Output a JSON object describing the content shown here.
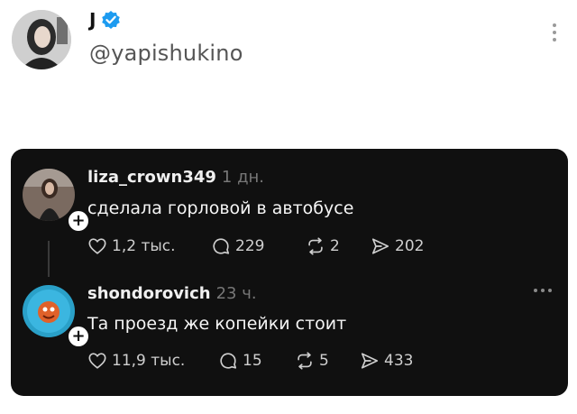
{
  "header": {
    "display_name": "J",
    "handle": "@yapishukino",
    "verified_icon": "verified-badge-icon",
    "menu_icon": "more-vertical-icon"
  },
  "colors": {
    "verified_blue": "#1d9bf0",
    "card_bg": "#101010",
    "muted": "#777777"
  },
  "thread": {
    "posts": [
      {
        "username": "liza_crown349",
        "time": "1 дн.",
        "text": "сделала горловой в автобусе",
        "likes": "1,2 тыс.",
        "replies": "229",
        "reposts": "2",
        "shares": "202"
      },
      {
        "username": "shondorovich",
        "time": "23 ч.",
        "text": "Та проезд же копейки стоит",
        "likes": "11,9 тыс.",
        "replies": "15",
        "reposts": "5",
        "shares": "433"
      }
    ]
  }
}
